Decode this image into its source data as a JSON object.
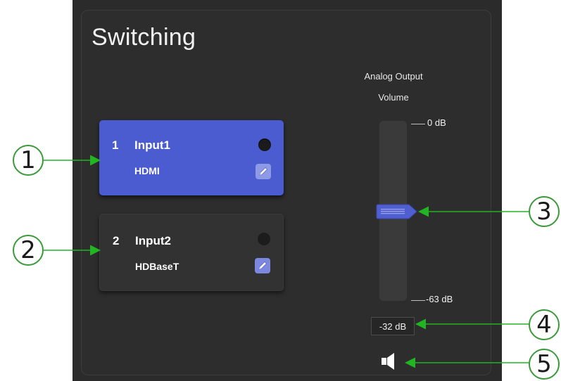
{
  "panel": {
    "title": "Switching"
  },
  "inputs": [
    {
      "number": "1",
      "name": "Input1",
      "type": "HDMI",
      "selected": true
    },
    {
      "number": "2",
      "name": "Input2",
      "type": "HDBaseT",
      "selected": false
    }
  ],
  "volume": {
    "label_line1": "Analog Output",
    "label_line2": "Volume",
    "max_label": "0 dB",
    "min_label": "-63 dB",
    "readout": "-32 dB",
    "level_db": -32,
    "min_db": -63,
    "max_db": 0
  },
  "callouts": [
    "1",
    "2",
    "3",
    "4",
    "5"
  ],
  "colors": {
    "accent": "#4b5bd0",
    "callout_arrow": "#22b522",
    "panel_bg": "#2b2b2b"
  },
  "icons": {
    "edit": "pencil-icon",
    "status": "status-dot-icon",
    "mute": "speaker-icon"
  }
}
